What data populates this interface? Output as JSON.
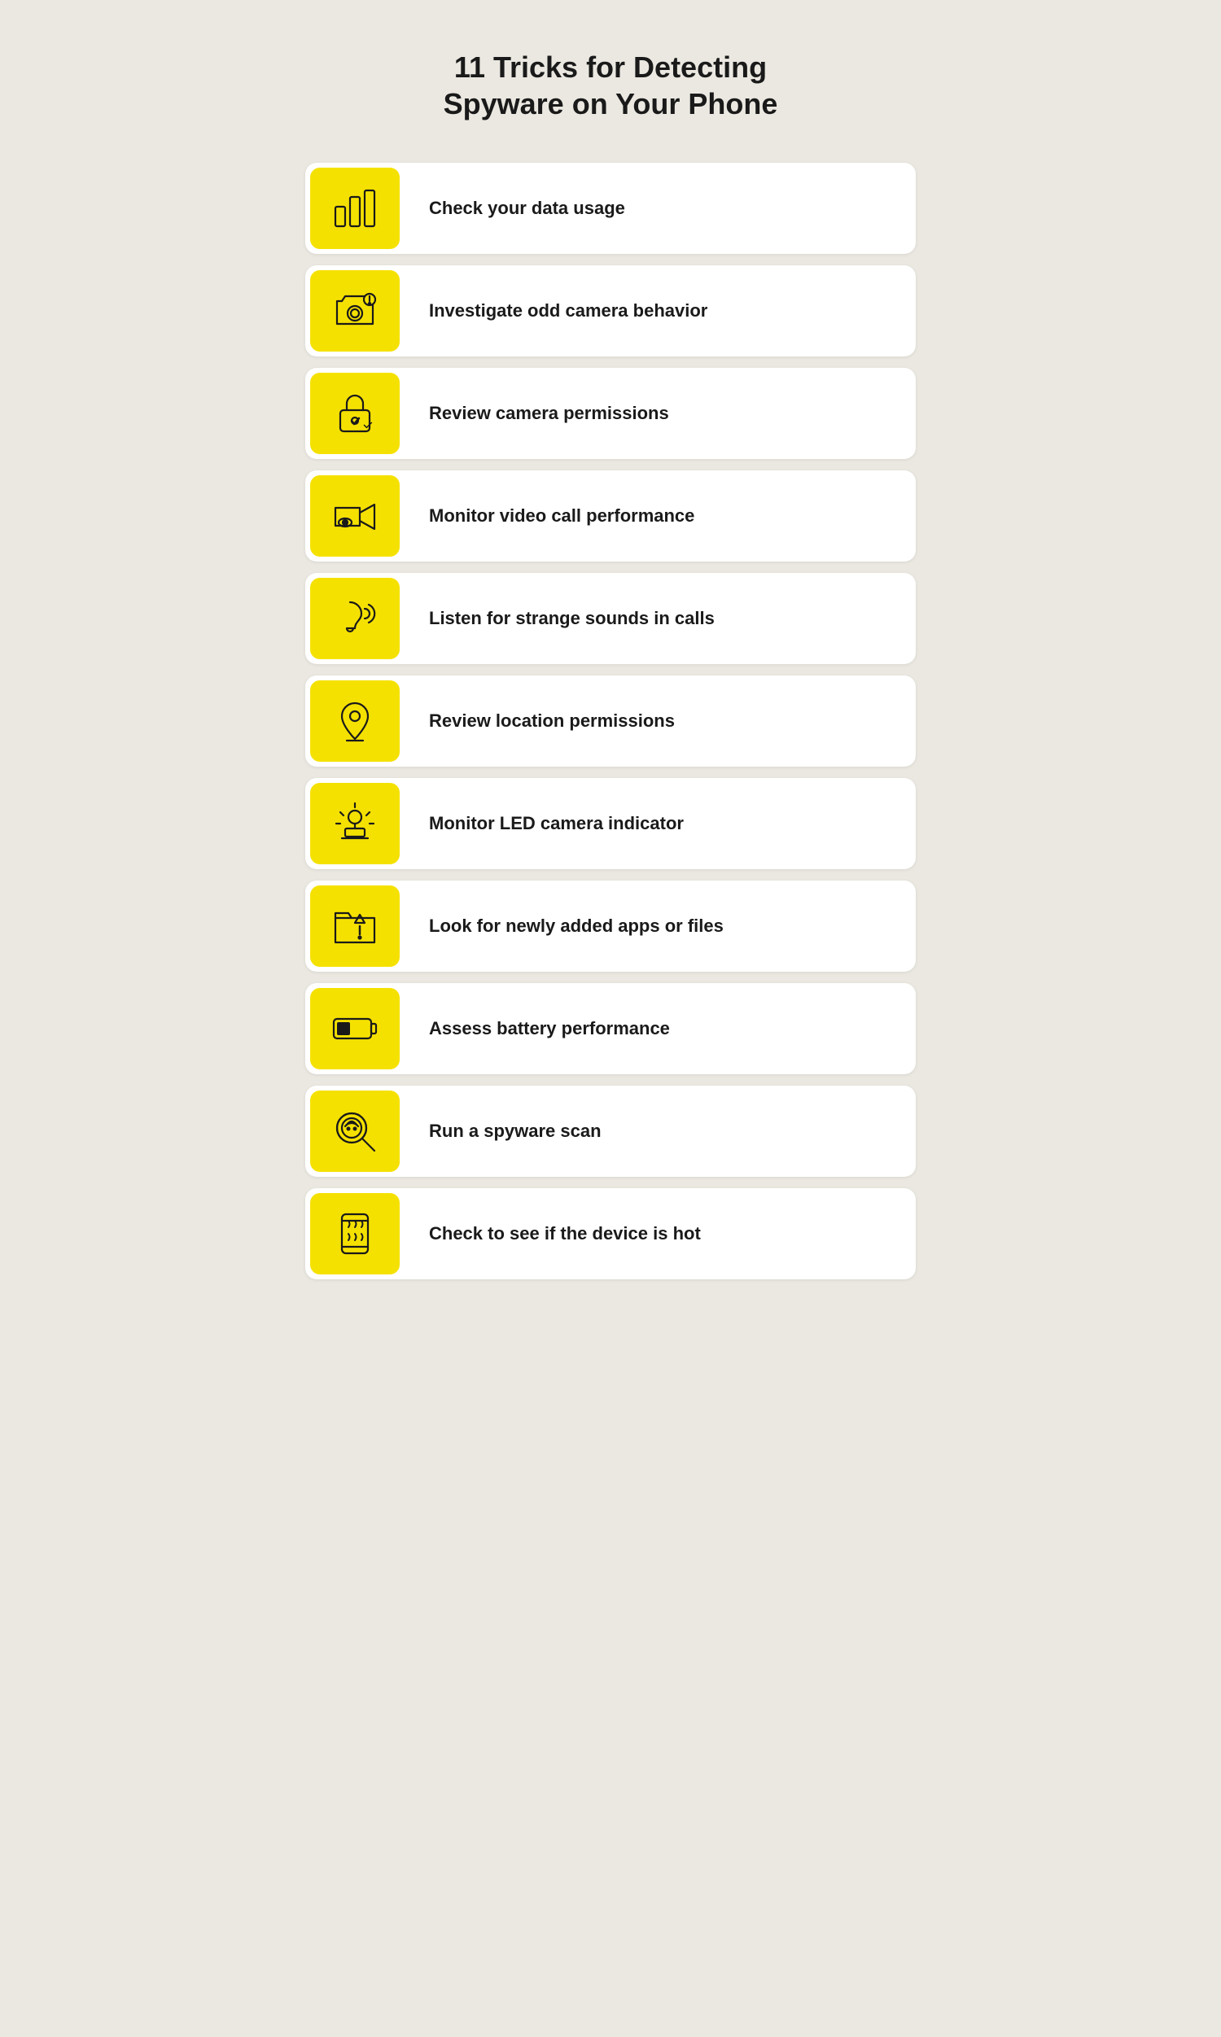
{
  "page": {
    "title_line1": "11 Tricks for Detecting",
    "title_line2": "Spyware on Your Phone",
    "background_color": "#eae8e0",
    "accent_color": "#f5e100"
  },
  "items": [
    {
      "id": 1,
      "label": "Check your data usage",
      "icon": "bar-chart"
    },
    {
      "id": 2,
      "label": "Investigate odd camera behavior",
      "icon": "camera-alert"
    },
    {
      "id": 3,
      "label": "Review camera permissions",
      "icon": "lock-check"
    },
    {
      "id": 4,
      "label": "Monitor video call performance",
      "icon": "video-eye"
    },
    {
      "id": 5,
      "label": "Listen for strange sounds in calls",
      "icon": "ear-sound"
    },
    {
      "id": 6,
      "label": "Review location permissions",
      "icon": "location-pin"
    },
    {
      "id": 7,
      "label": "Monitor LED camera indicator",
      "icon": "alarm-light"
    },
    {
      "id": 8,
      "label": "Look for newly added apps or files",
      "icon": "folder-alert"
    },
    {
      "id": 9,
      "label": "Assess battery performance",
      "icon": "battery-low"
    },
    {
      "id": 10,
      "label": "Run a spyware scan",
      "icon": "spy-search"
    },
    {
      "id": 11,
      "label": "Check to see if the device is hot",
      "icon": "phone-hot"
    }
  ]
}
